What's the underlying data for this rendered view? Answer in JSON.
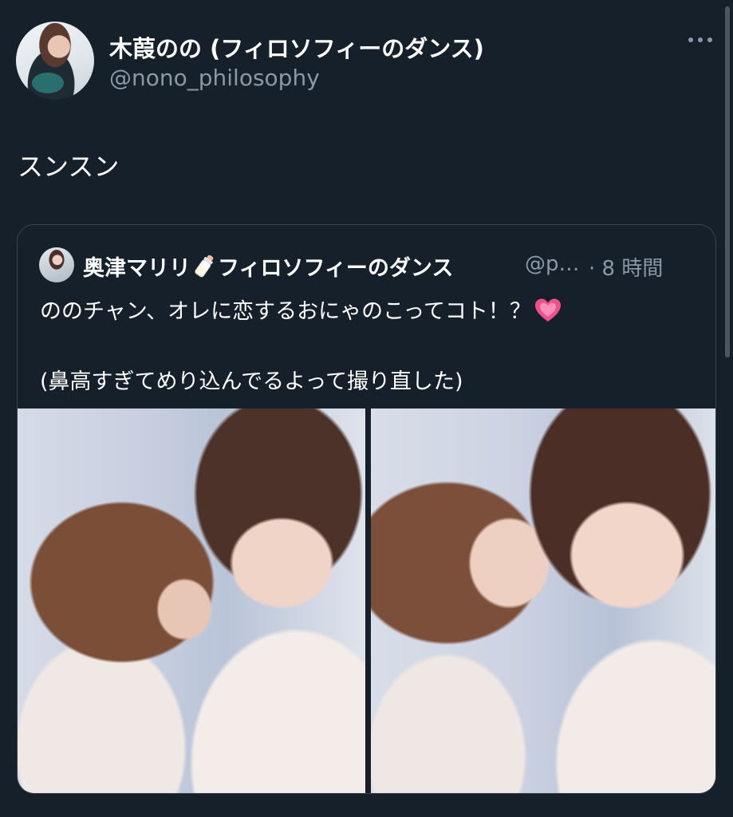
{
  "author": {
    "display_name": "木葭のの (フィロソフィーのダンス)",
    "handle": "@nono_philosophy",
    "avatar_icon": "avatar-photo"
  },
  "tweet": {
    "text": "スンスン"
  },
  "quoted_tweet": {
    "name_part1": "奥津マリリ",
    "name_emoji": "baby-bottle-icon",
    "name_part2": "フィロソフィーのダンス",
    "handle": "@p…",
    "time": "· 8 時間",
    "line1": "ののチャン、オレに恋するおにゃのこってコト！？",
    "line1_emoji": "growing-heart-icon",
    "line2": "(鼻高すぎてめり込んでるよって撮り直した)",
    "photos": [
      {
        "alt_icon": "photo-1"
      },
      {
        "alt_icon": "photo-2"
      }
    ]
  },
  "colors": {
    "background": "#15202b",
    "secondary_text": "#8b98a5",
    "border": "#38444d",
    "heart": "#f0508a"
  },
  "icons": {
    "more": "more-horizontal-icon"
  }
}
